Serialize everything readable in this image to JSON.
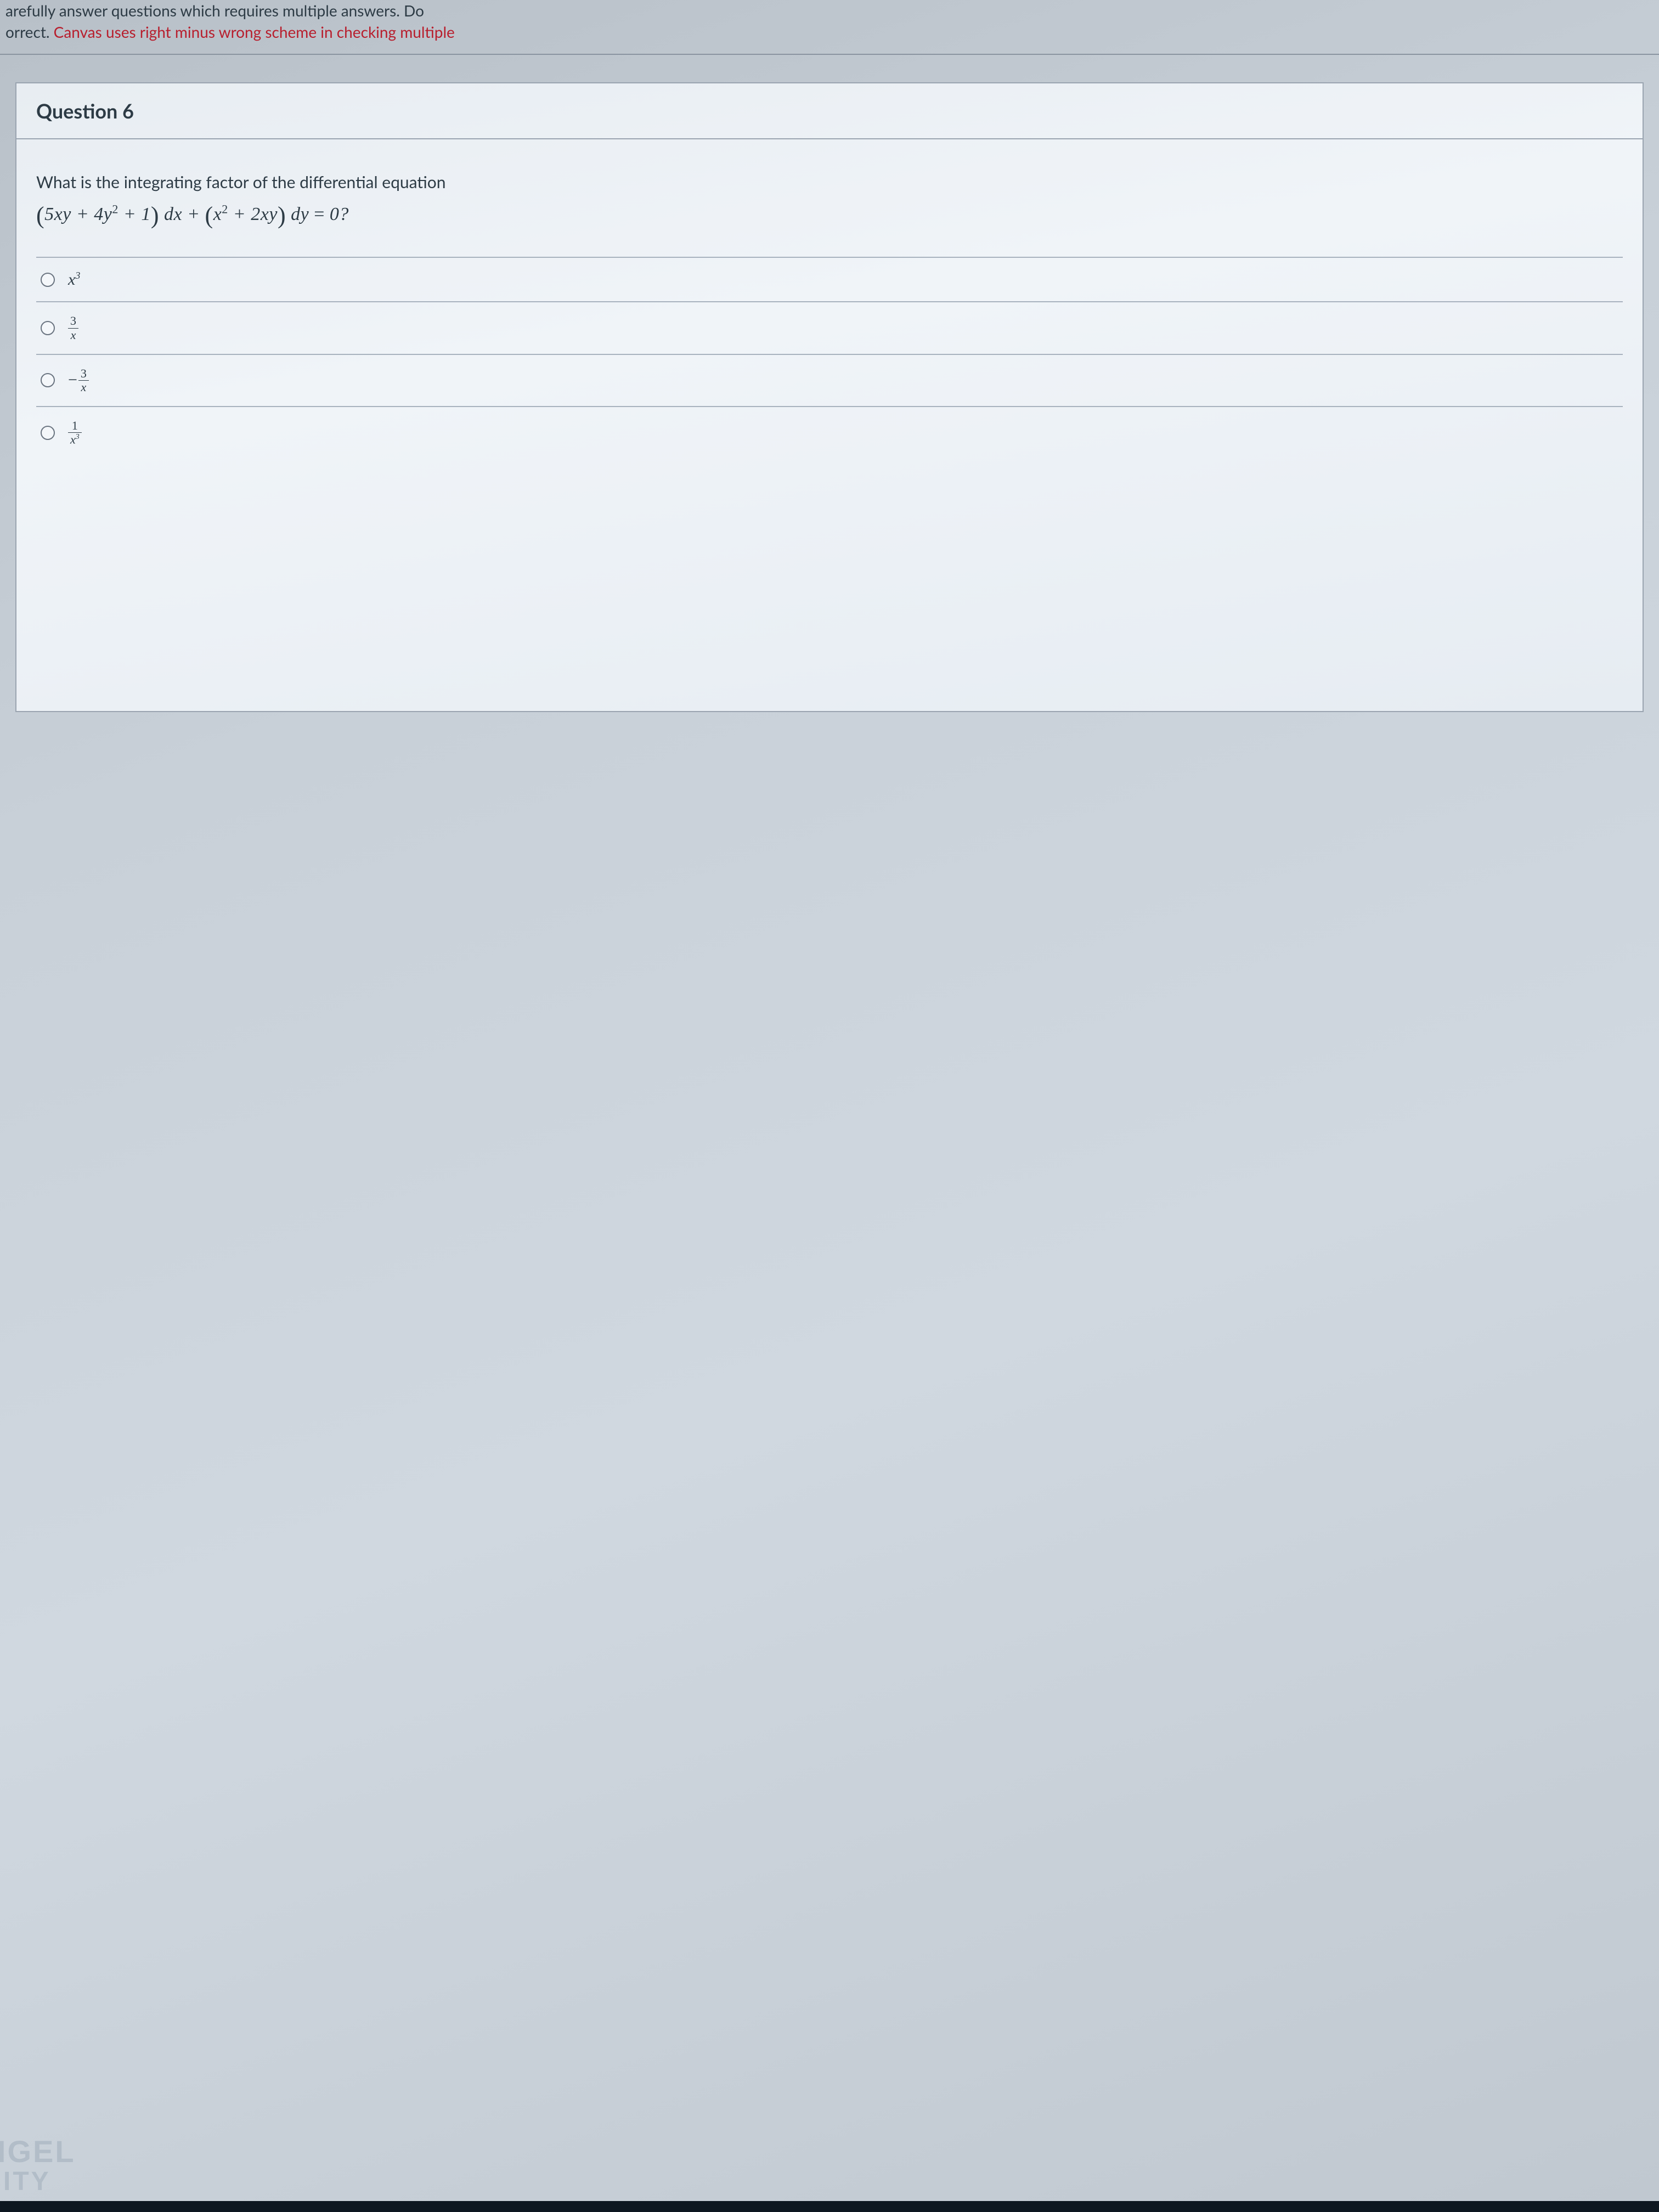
{
  "instruction": {
    "line1_partial": "arefully answer questions which requires multiple answers. Do",
    "line2_black": "orrect. ",
    "line2_red": "Canvas uses right minus wrong scheme in checking multiple "
  },
  "question": {
    "title": "Question 6",
    "prompt": "What is the integrating factor of the differential equation",
    "equation_display": "(5xy + 4y² + 1) dx + (x² + 2xy) dy = 0?",
    "options": [
      {
        "id": "opt1",
        "latex": "x^3",
        "type": "power"
      },
      {
        "id": "opt2",
        "latex": "3/x",
        "type": "frac",
        "num": "3",
        "den": "x"
      },
      {
        "id": "opt3",
        "latex": "-3/x",
        "type": "negfrac",
        "num": "3",
        "den": "x"
      },
      {
        "id": "opt4",
        "latex": "1/x^3",
        "type": "frac",
        "num": "1",
        "den": "x³"
      }
    ]
  },
  "watermark": {
    "line1": "NGEL",
    "line2": "SITY"
  }
}
